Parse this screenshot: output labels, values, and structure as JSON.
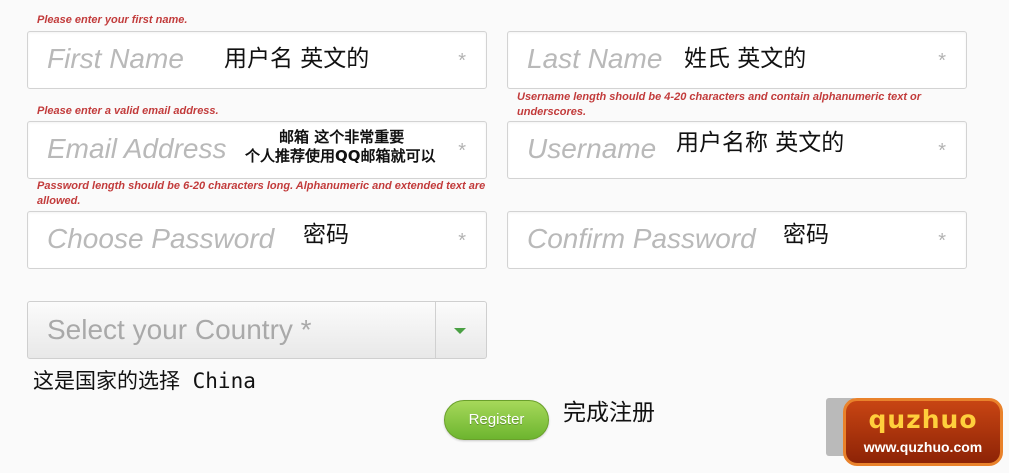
{
  "errors": {
    "first_name": "Please enter your first name.",
    "email": "Please enter a valid email address.",
    "username": "Username length should be 4-20 characters and contain alphanumeric text or underscores.",
    "password": "Password length should be 6-20 characters long. Alphanumeric and extended text are allowed."
  },
  "fields": {
    "first_name": {
      "placeholder": "First Name",
      "required": "*",
      "note": "用户名 英文的"
    },
    "last_name": {
      "placeholder": "Last Name",
      "required": "*",
      "note": "姓氏 英文的"
    },
    "email": {
      "placeholder": "Email Address",
      "required": "*",
      "note_line1": "邮箱 这个非常重要",
      "note_line2": "个人推荐使用QQ邮箱就可以"
    },
    "username": {
      "placeholder": "Username",
      "required": "*",
      "note": "用户名称 英文的"
    },
    "password": {
      "placeholder": "Choose Password",
      "required": "*",
      "note": "密码"
    },
    "confirm_password": {
      "placeholder": "Confirm Password",
      "required": "*",
      "note": "密码"
    }
  },
  "country": {
    "placeholder": "Select your Country *",
    "note": "这是国家的选择 China"
  },
  "register": {
    "label": "Register",
    "note": "完成注册"
  },
  "watermark": {
    "title": "quzhuo",
    "url": "www.quzhuo.com"
  },
  "colors": {
    "error": "#c23b3b",
    "button": "#7cc13b",
    "caret": "#4aa043",
    "watermark": "#c84513"
  }
}
